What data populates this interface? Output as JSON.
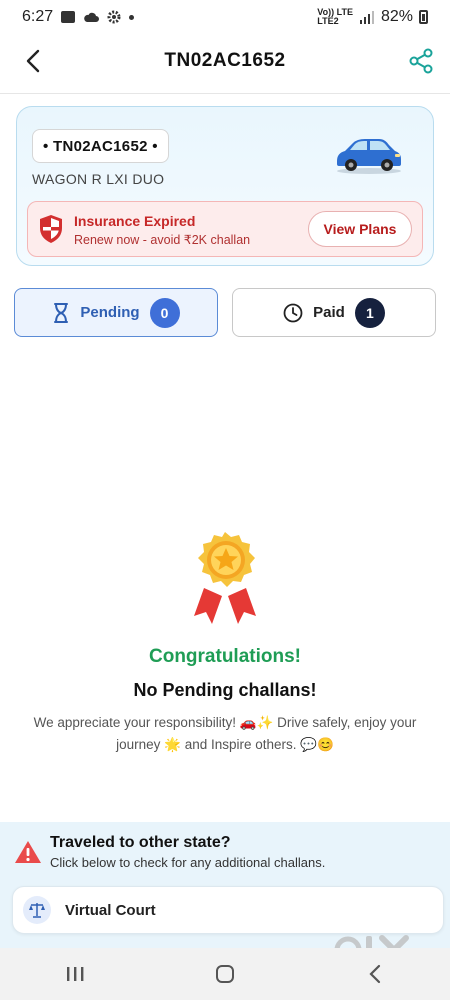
{
  "status_bar": {
    "time": "6:27",
    "network_top": "Vo)) LTE",
    "network_bottom": "LTE2",
    "battery": "82%"
  },
  "header": {
    "title": "TN02AC1652",
    "back_icon": "chevron-left-icon",
    "share_icon": "share-icon"
  },
  "vehicle": {
    "plate": "• TN02AC1652 •",
    "model": "WAGON R LXI DUO",
    "car_color": "#2e6fd1"
  },
  "insurance": {
    "title": "Insurance Expired",
    "subtitle": "Renew now - avoid ₹2K challan",
    "cta": "View Plans",
    "accent": "#c62828"
  },
  "tabs": [
    {
      "label": "Pending",
      "count": "0",
      "icon": "hourglass-icon",
      "selected": true
    },
    {
      "label": "Paid",
      "count": "1",
      "icon": "clock-icon",
      "selected": false
    }
  ],
  "empty_state": {
    "icon": "medal-icon",
    "heading": "Congratulations!",
    "subheading": "No Pending challans!",
    "message": "We appreciate your responsibility! 🚗✨ Drive safely, enjoy your journey 🌟 and Inspire others. 💬😊",
    "heading_color": "#1f9d55"
  },
  "travel": {
    "title": "Traveled to other state?",
    "subtitle": "Click below to check for any additional challans.",
    "court_label": "Virtual Court",
    "court_icon": "scales-icon"
  },
  "watermark": "OLX",
  "nav": {
    "recent_icon": "recent-apps-icon",
    "home_icon": "home-icon",
    "back_icon": "back-icon"
  }
}
